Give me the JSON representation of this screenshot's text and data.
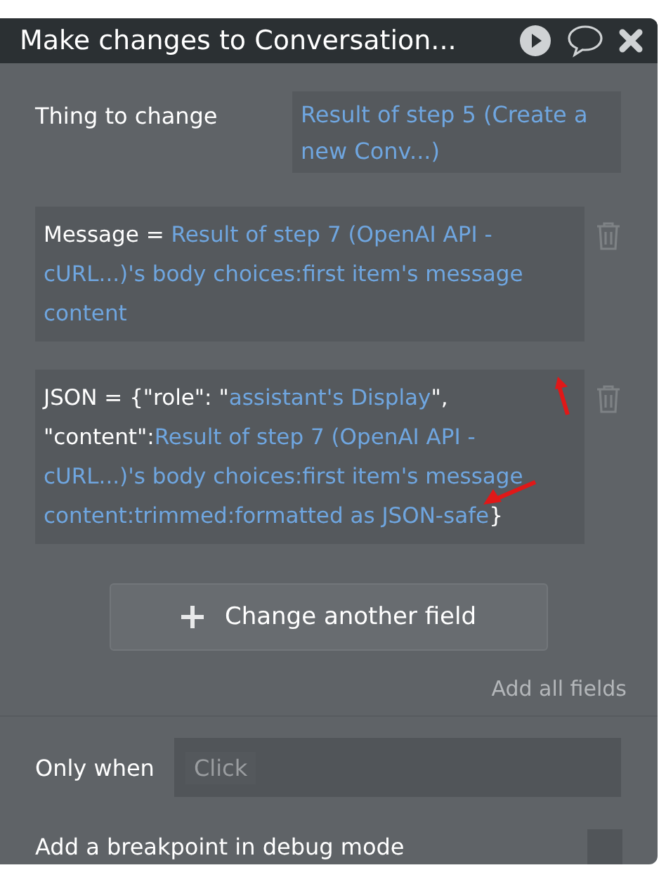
{
  "window": {
    "title": "Make changes to Conversation..."
  },
  "thing_to_change": {
    "label": "Thing to change",
    "value": "Result of step 5 (Create a new Conv...)"
  },
  "fields": [
    {
      "label": "Message =",
      "segments": [
        {
          "kind": "dynamic",
          "text": "Result of step 7 (OpenAI API - cURL...)'s body choices:first item's message content"
        }
      ]
    },
    {
      "label": "JSON =",
      "segments": [
        {
          "kind": "literal",
          "text": "{\"role\": \""
        },
        {
          "kind": "dynamic",
          "text": "assistant's Display"
        },
        {
          "kind": "literal",
          "text": "\", \"content\":"
        },
        {
          "kind": "dynamic",
          "text": "Result of step 7 (OpenAI API - cURL...)'s body choices:first item's message content:trimmed:formatted as JSON-safe"
        },
        {
          "kind": "literal",
          "text": "}"
        }
      ]
    }
  ],
  "change_button": {
    "label": "Change another field"
  },
  "add_all_link": "Add all fields",
  "only_when": {
    "label": "Only when",
    "placeholder": "Click"
  },
  "breakpoint": {
    "label": "Add a breakpoint in debug mode",
    "checked": false
  }
}
